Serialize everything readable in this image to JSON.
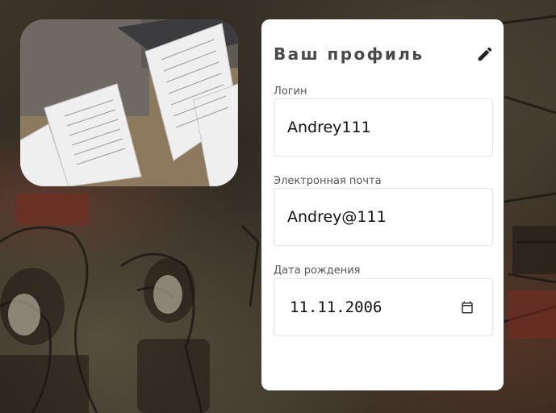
{
  "profile": {
    "title": "Ваш профиль",
    "edit_icon": "pencil-icon",
    "fields": {
      "login": {
        "label": "Логин",
        "value": "Andrey111"
      },
      "email": {
        "label": "Электронная почта",
        "value": "Andrey@111"
      },
      "birthdate": {
        "label": "Дата рождения",
        "value": "11.11.2006",
        "icon": "calendar-icon"
      }
    }
  },
  "photo": {
    "subject": "papers-on-desk-image"
  },
  "colors": {
    "card_bg": "#ffffff",
    "title_text": "#4a4a4a",
    "label_text": "#555555",
    "value_text": "#111111",
    "field_border": "#e3e3e3"
  }
}
